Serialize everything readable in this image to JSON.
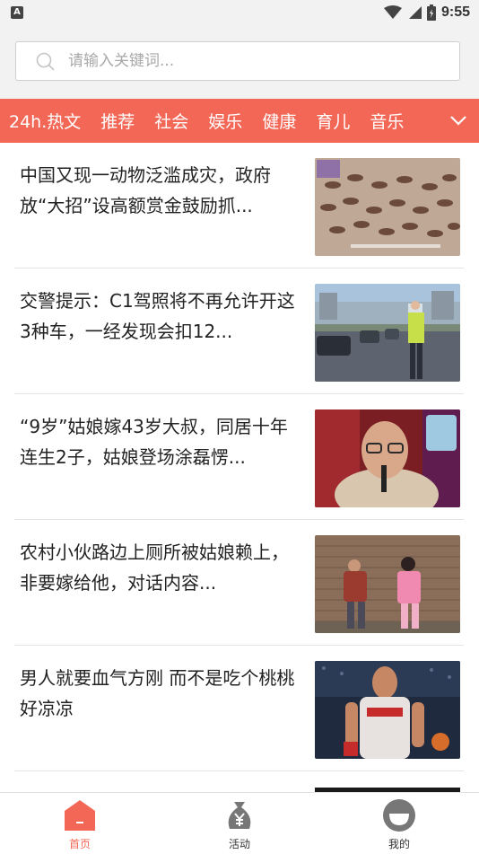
{
  "status_bar": {
    "time": "9:55",
    "app_badge": "A"
  },
  "search": {
    "placeholder": "请输入关键词..."
  },
  "tabs": [
    "24h.热文",
    "推荐",
    "社会",
    "娱乐",
    "健康",
    "育儿",
    "音乐"
  ],
  "news": [
    {
      "title": "中国又现一动物泛滥成灾，政府放“大招”设高额赏金鼓励抓..."
    },
    {
      "title": "交警提示：C1驾照将不再允许开这3种车，一经发现会扣12..."
    },
    {
      "title": "“9岁”姑娘嫁43岁大叔，同居十年连生2子，姑娘登场涂磊愣..."
    },
    {
      "title": "农村小伙路边上厕所被姑娘赖上，非要嫁给他，对话内容..."
    },
    {
      "title": "男人就要血气方刚 而不是吃个桃桃 好凉凉"
    }
  ],
  "bottom_nav": [
    {
      "label": "首页",
      "active": true,
      "icon": "home-icon"
    },
    {
      "label": "活动",
      "active": false,
      "icon": "money-bag-icon"
    },
    {
      "label": "我的",
      "active": false,
      "icon": "profile-icon"
    }
  ],
  "colors": {
    "accent": "#f36756",
    "tabbar_bg": "#f36756",
    "page_bg": "#ffffff",
    "search_bg": "#f2f2f2"
  }
}
